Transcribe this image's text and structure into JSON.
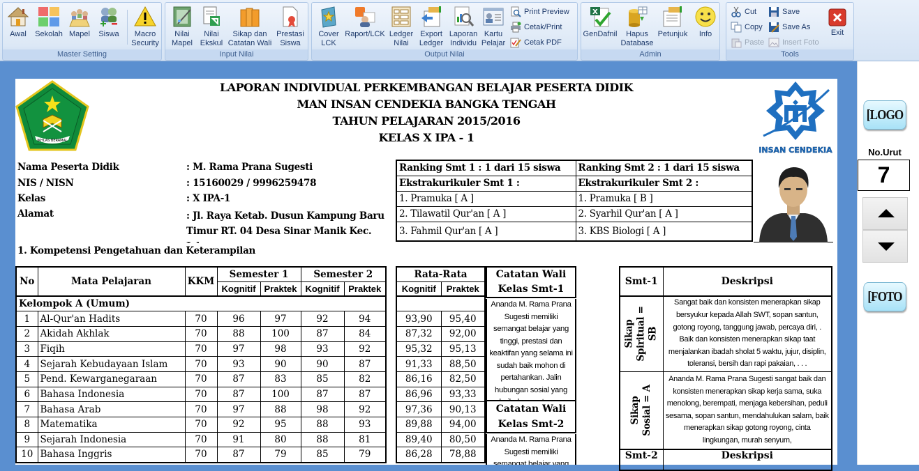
{
  "ribbon": {
    "groups": [
      {
        "label": "Master Setting",
        "buttons": [
          {
            "label": "Awal",
            "icon": "home-icon"
          },
          {
            "label": "Sekolah",
            "icon": "color-grid-icon"
          },
          {
            "label": "Mapel",
            "icon": "meeting-icon"
          },
          {
            "label": "Siswa",
            "icon": "users-add-remove-icon"
          },
          {
            "label": "Macro\nSecurity",
            "icon": "warning-icon"
          }
        ]
      },
      {
        "label": "Input Nilai",
        "buttons": [
          {
            "label": "Nilai\nMapel",
            "icon": "notebook-wand-icon"
          },
          {
            "label": "Nilai\nEkskul",
            "icon": "document-arrow-icon"
          },
          {
            "label": "Sikap dan\nCatatan Wali",
            "icon": "books-icon"
          },
          {
            "label": "Prestasi\nSiswa",
            "icon": "certificate-icon"
          }
        ]
      },
      {
        "label": "Output Nilai",
        "buttons": [
          {
            "label": "Cover\nLCK",
            "icon": "book-star-icon"
          },
          {
            "label": "Raport/LCK",
            "icon": "rss-user-icon"
          },
          {
            "label": "Ledger\nNilai",
            "icon": "ledger-icon"
          },
          {
            "label": "Export\nLedger",
            "icon": "export-icon"
          },
          {
            "label": "Laporan\nIndividu",
            "icon": "report-magnifier-icon"
          },
          {
            "label": "Kartu\nPelajar",
            "icon": "id-card-icon"
          }
        ],
        "small_buttons": [
          {
            "label": "Print Preview",
            "icon": "print-preview-icon"
          },
          {
            "label": "Cetak/Print",
            "icon": "printer-icon"
          },
          {
            "label": "Cetak PDF",
            "icon": "pdf-edit-icon"
          }
        ]
      },
      {
        "label": "Admin",
        "buttons": [
          {
            "label": "GenDafnil",
            "icon": "excel-check-icon"
          },
          {
            "label": "Hapus\nDatabase",
            "icon": "database-icon"
          },
          {
            "label": "Petunjuk",
            "icon": "guide-icon"
          },
          {
            "label": "Info",
            "icon": "smiley-icon"
          }
        ]
      },
      {
        "label": "Tools",
        "small_buttons": [
          {
            "label": "Cut",
            "icon": "scissors-icon",
            "enabled": true
          },
          {
            "label": "Copy",
            "icon": "copy-icon",
            "enabled": true
          },
          {
            "label": "Paste",
            "icon": "paste-icon",
            "enabled": false
          },
          {
            "label": "Save",
            "icon": "floppy-icon",
            "enabled": true
          },
          {
            "label": "Save As",
            "icon": "save-as-icon",
            "enabled": true
          },
          {
            "label": "Insert Foto",
            "icon": "picture-icon",
            "enabled": false
          }
        ],
        "buttons": [
          {
            "label": "Exit",
            "icon": "close-icon"
          }
        ]
      }
    ]
  },
  "report": {
    "title_lines": [
      "LAPORAN INDIVIDUAL PERKEMBANGAN BELAJAR PESERTA DIDIK",
      "MAN INSAN CENDEKIA BANGKA TENGAH",
      "TAHUN PELAJARAN 2015/2016",
      "KELAS X IPA - 1"
    ],
    "right_logo_text": "INSAN CENDEKIA",
    "left_logo_text": "IKHLAS BERAMAL",
    "student": [
      {
        "label": "Nama Peserta Didik",
        "value": ": M. Rama Prana Sugesti"
      },
      {
        "label": "NIS / NISN",
        "value": ": 15160029 / 9996259478"
      },
      {
        "label": "Kelas",
        "value": ": X IPA-1"
      },
      {
        "label": "Alamat",
        "value": ": Jl. Raya Ketab. Dusun Kampung Baru",
        "value2": "Timur RT. 04 Desa Sinar Manik Kec.",
        "value3": "Jebus"
      }
    ],
    "ranking": {
      "smt1": "Ranking Smt 1 : 1 dari 15 siswa",
      "smt2": "Ranking Smt 2 : 1 dari 15 siswa",
      "ekskul_smt1_label": "Ekstrakurikuler Smt 1  :",
      "ekskul_smt2_label": "Ekstrakurikuler Smt 2  :",
      "ekskul_smt1": [
        "1. Pramuka [ A ]",
        "2. Tilawatil Qur'an [ A ]",
        "3. Fahmil Qur'an [ A ]"
      ],
      "ekskul_smt2": [
        "1. Pramuka [ B ]",
        "2. Syarhil Qur'an [ A ]",
        "3. KBS Biologi [ A ]"
      ]
    },
    "section1_title": "1. Kompetensi Pengetahuan dan Keterampilan",
    "grades": {
      "headers": {
        "no": "No",
        "mapel": "Mata Pelajaran",
        "kkm": "KKM",
        "smt1": "Semester 1",
        "smt2": "Semester 2",
        "kognitif": "Kognitif",
        "praktek": "Praktek"
      },
      "group_label": "Kelompok A (Umum)",
      "rows": [
        {
          "no": "1",
          "mapel": "Al-Qur'an Hadits",
          "kkm": "70",
          "s1k": "96",
          "s1p": "97",
          "s2k": "92",
          "s2p": "94",
          "avg_k": "93,90",
          "avg_p": "95,40"
        },
        {
          "no": "2",
          "mapel": "Akidah Akhlak",
          "kkm": "70",
          "s1k": "88",
          "s1p": "100",
          "s2k": "87",
          "s2p": "84",
          "avg_k": "87,32",
          "avg_p": "92,00"
        },
        {
          "no": "3",
          "mapel": "Fiqih",
          "kkm": "70",
          "s1k": "97",
          "s1p": "98",
          "s2k": "93",
          "s2p": "92",
          "avg_k": "95,32",
          "avg_p": "95,13"
        },
        {
          "no": "4",
          "mapel": "Sejarah Kebudayaan Islam",
          "kkm": "70",
          "s1k": "93",
          "s1p": "90",
          "s2k": "90",
          "s2p": "87",
          "avg_k": "91,33",
          "avg_p": "88,50"
        },
        {
          "no": "5",
          "mapel": "Pend. Kewarganegaraan",
          "kkm": "70",
          "s1k": "87",
          "s1p": "83",
          "s2k": "85",
          "s2p": "82",
          "avg_k": "86,16",
          "avg_p": "82,50"
        },
        {
          "no": "6",
          "mapel": "Bahasa Indonesia",
          "kkm": "70",
          "s1k": "87",
          "s1p": "100",
          "s2k": "87",
          "s2p": "87",
          "avg_k": "86,96",
          "avg_p": "93,33"
        },
        {
          "no": "7",
          "mapel": "Bahasa Arab",
          "kkm": "70",
          "s1k": "97",
          "s1p": "88",
          "s2k": "98",
          "s2p": "92",
          "avg_k": "97,36",
          "avg_p": "90,13"
        },
        {
          "no": "8",
          "mapel": "Matematika",
          "kkm": "70",
          "s1k": "92",
          "s1p": "95",
          "s2k": "88",
          "s2p": "93",
          "avg_k": "89,88",
          "avg_p": "94,00"
        },
        {
          "no": "9",
          "mapel": "Sejarah Indonesia",
          "kkm": "70",
          "s1k": "91",
          "s1p": "80",
          "s2k": "88",
          "s2p": "81",
          "avg_k": "89,40",
          "avg_p": "80,50"
        },
        {
          "no": "10",
          "mapel": "Bahasa Inggris",
          "kkm": "70",
          "s1k": "87",
          "s1p": "79",
          "s2k": "85",
          "s2p": "79",
          "avg_k": "86,28",
          "avg_p": "78,88"
        }
      ]
    },
    "average_header": "Rata-Rata",
    "catatan_smt1_title": "Catatan Wali Kelas Smt-1",
    "catatan_smt1_text": "Ananda M. Rama Prana Sugesti memiliki semangat belajar yang tinggi, prestasi dan keaktifan yang selama ini sudah baik mohon di pertahankan. Jalin hubungan sosial yang baik dengan teman",
    "catatan_smt2_title": "Catatan Wali Kelas Smt-2",
    "catatan_smt2_text": "Ananda M. Rama Prana Sugesti memiliki semangat belajar yang tinggi",
    "deskripsi": {
      "col1": "Smt-1",
      "col2": "Deskripsi",
      "col1_smt2": "Smt-2",
      "rows": [
        {
          "label_line1": "Sikap",
          "label_line2": "Spiritual =",
          "label_line3": "SB",
          "text": "Sangat baik dan konsisten menerapkan sikap bersyukur kepada Allah SWT, sopan santun, gotong royong, tanggung jawab, percaya diri, . Baik dan konsisten menerapkan sikap taat menjalankan ibadah sholat 5 waktu, jujur, disiplin, toleransi, bersih dan rapi pakaian, . . ."
        },
        {
          "label_line1": "Sikap",
          "label_line2": "Sosial = A",
          "label_line3": "",
          "text": "Ananda M. Rama Prana Sugesti sangat baik dan konsisten menerapkan sikap kerja sama, suka menolong,  berempati, menjaga kebersihan, peduli sesama, sopan santun,  mendahulukan salam, baik menerapkan sikap   gotong royong, cinta lingkungan,   murah senyum,"
        }
      ]
    }
  },
  "side": {
    "logo_button": "[LOGO",
    "no_urut_label": "No.Urut",
    "no_urut_value": "7",
    "foto_button": "[FOTO"
  }
}
